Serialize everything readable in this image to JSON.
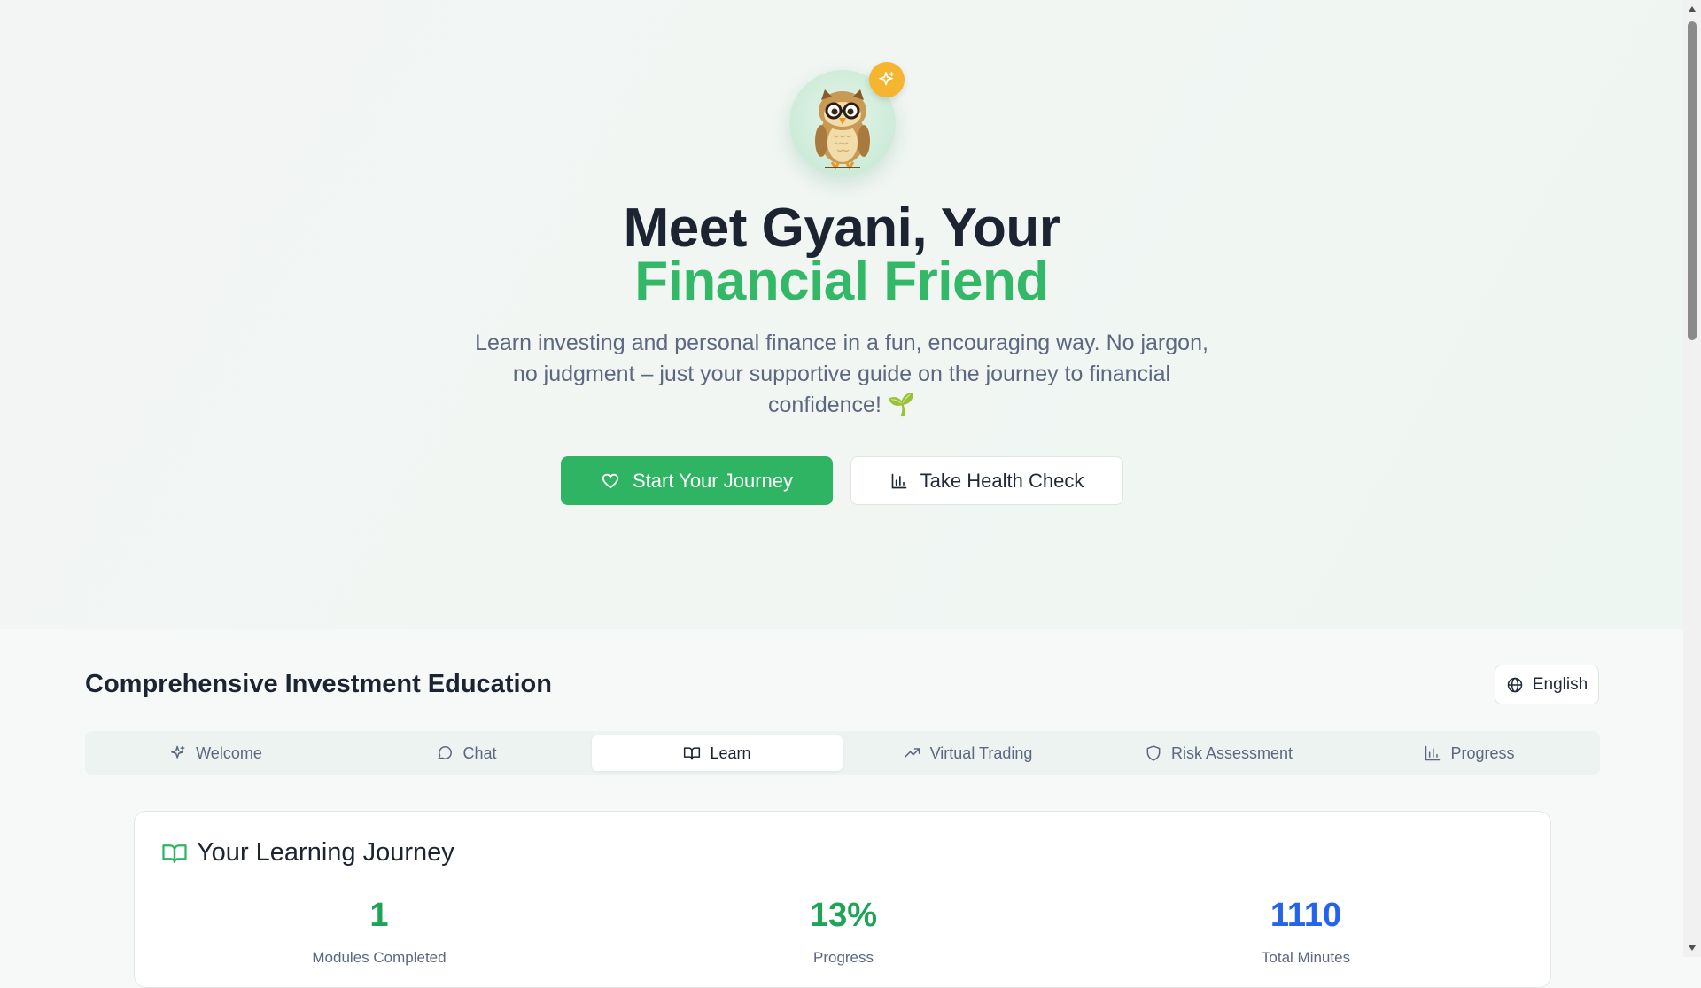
{
  "hero": {
    "title_line1": "Meet Gyani, Your",
    "title_line2": "Financial Friend",
    "subtitle": "Learn investing and personal finance in a fun, encouraging way. No jargon, no judgment – just your supportive guide on the journey to financial confidence! 🌱",
    "primary_button": "Start Your Journey",
    "secondary_button": "Take Health Check",
    "primary_icon": "heart-icon",
    "secondary_icon": "bar-chart-icon",
    "badge_icon": "sparkle-icon",
    "mascot": "owl-mascot"
  },
  "section": {
    "title": "Comprehensive Investment Education",
    "language": "English",
    "language_icon": "globe-icon"
  },
  "tabs": [
    {
      "label": "Welcome",
      "icon": "sparkle-icon",
      "active": false
    },
    {
      "label": "Chat",
      "icon": "message-icon",
      "active": false
    },
    {
      "label": "Learn",
      "icon": "book-icon",
      "active": true
    },
    {
      "label": "Virtual Trading",
      "icon": "trending-up-icon",
      "active": false
    },
    {
      "label": "Risk Assessment",
      "icon": "shield-icon",
      "active": false
    },
    {
      "label": "Progress",
      "icon": "bar-chart-icon",
      "active": false
    }
  ],
  "learning": {
    "title": "Your Learning Journey",
    "icon": "book-icon",
    "stats": [
      {
        "value": "1",
        "label": "Modules Completed",
        "color": "#1fa457"
      },
      {
        "value": "13%",
        "label": "Progress",
        "color": "#1fa457"
      },
      {
        "value": "1110",
        "label": "Total Minutes",
        "color": "#2563eb"
      }
    ]
  },
  "colors": {
    "accent": "#33b868",
    "primary_button": "#2fb464",
    "badge": "#f6b52e",
    "blue_stat": "#2563eb"
  }
}
